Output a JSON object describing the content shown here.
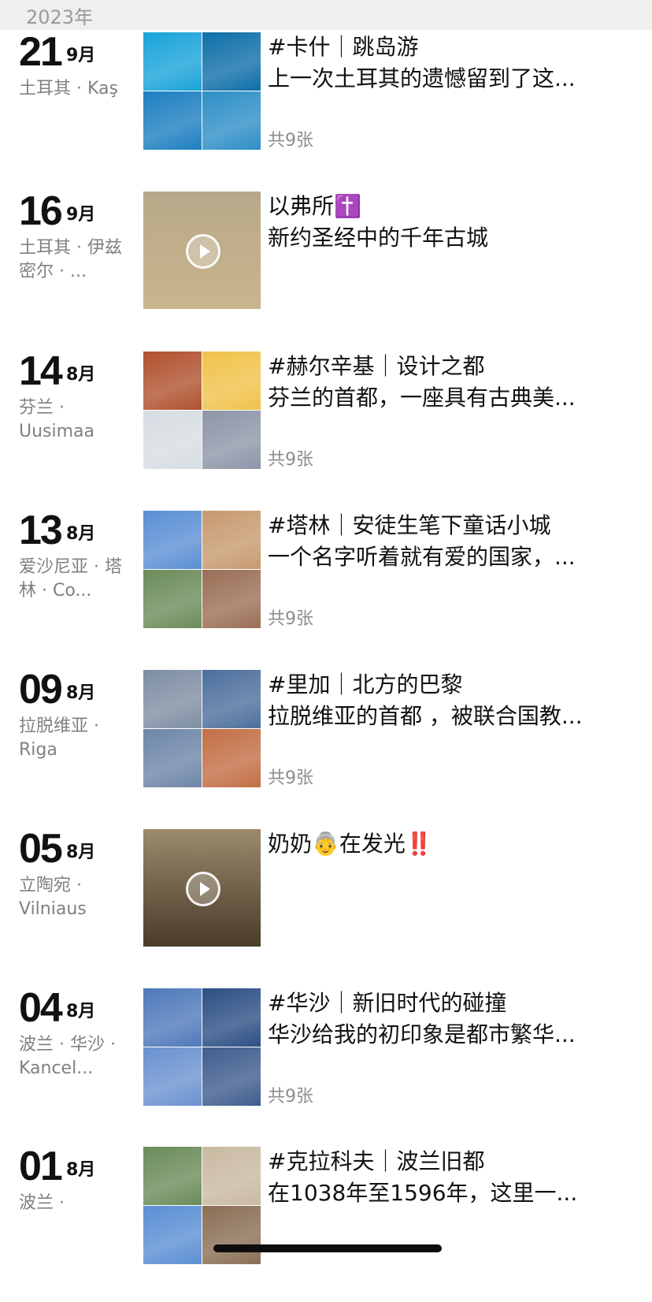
{
  "year_label": "2023年",
  "entries": [
    {
      "day": "21",
      "month": "9月",
      "location": "土耳其 · Kaş",
      "title": "#卡什｜跳岛游",
      "desc": "上一次土耳其的遗憾留到了这...",
      "count": "共9张",
      "thumb_type": "grid",
      "colors": [
        "#1aa3d9",
        "#0f6fa8",
        "#1d7fc0",
        "#2e8fc7"
      ]
    },
    {
      "day": "16",
      "month": "9月",
      "location": "土耳其 · 伊兹密尔 · ...",
      "title": "以弗所✝️",
      "desc": "新约圣经中的千年古城",
      "count": "",
      "thumb_type": "video",
      "colors": [
        "#b8a889",
        "#c9b58e"
      ]
    },
    {
      "day": "14",
      "month": "8月",
      "location": "芬兰 · Uusimaa",
      "title": "#赫尔辛基｜设计之都",
      "desc": "芬兰的首都，一座具有古典美...",
      "count": "共9张",
      "thumb_type": "grid",
      "colors": [
        "#b0522f",
        "#f0c24a",
        "#d6dde2",
        "#8d96a8"
      ]
    },
    {
      "day": "13",
      "month": "8月",
      "location": "爱沙尼亚 · 塔林 · Co...",
      "title": "#塔林｜安徒生笔下童话小城",
      "desc": "一个名字听着就有爱的国家，...",
      "count": "共9张",
      "thumb_type": "grid",
      "colors": [
        "#5b8fd4",
        "#c79a6f",
        "#6b8c5a",
        "#9a6f55"
      ]
    },
    {
      "day": "09",
      "month": "8月",
      "location": "拉脱维亚 · Riga",
      "title": "#里加｜北方的巴黎",
      "desc": "拉脱维亚的首都 ，被联合国教...",
      "count": "共9张",
      "thumb_type": "grid",
      "colors": [
        "#7f8ea3",
        "#4d6f9d",
        "#6d86a8",
        "#c26f45"
      ]
    },
    {
      "day": "05",
      "month": "8月",
      "location": "立陶宛 · Vilniaus",
      "title": "奶奶👵在发光‼️",
      "desc": "",
      "count": "",
      "thumb_type": "video",
      "colors": [
        "#9c8a6c",
        "#4a3b2a"
      ]
    },
    {
      "day": "04",
      "month": "8月",
      "location": "波兰 · 华沙 · Kancel...",
      "title": "#华沙｜新旧时代的碰撞",
      "desc": "华沙给我的初印象是都市繁华...",
      "count": "共9张",
      "thumb_type": "grid",
      "colors": [
        "#4f79ba",
        "#2d4f84",
        "#6b92d0",
        "#3f5d8e"
      ]
    },
    {
      "day": "01",
      "month": "8月",
      "location": "波兰 · ",
      "title": "#克拉科夫｜波兰旧都",
      "desc": "在1038年至1596年，这里一...",
      "count": "",
      "thumb_type": "grid",
      "colors": [
        "#6b8c5a",
        "#c9b9a1",
        "#5b8fd4",
        "#8a6f55"
      ]
    }
  ]
}
